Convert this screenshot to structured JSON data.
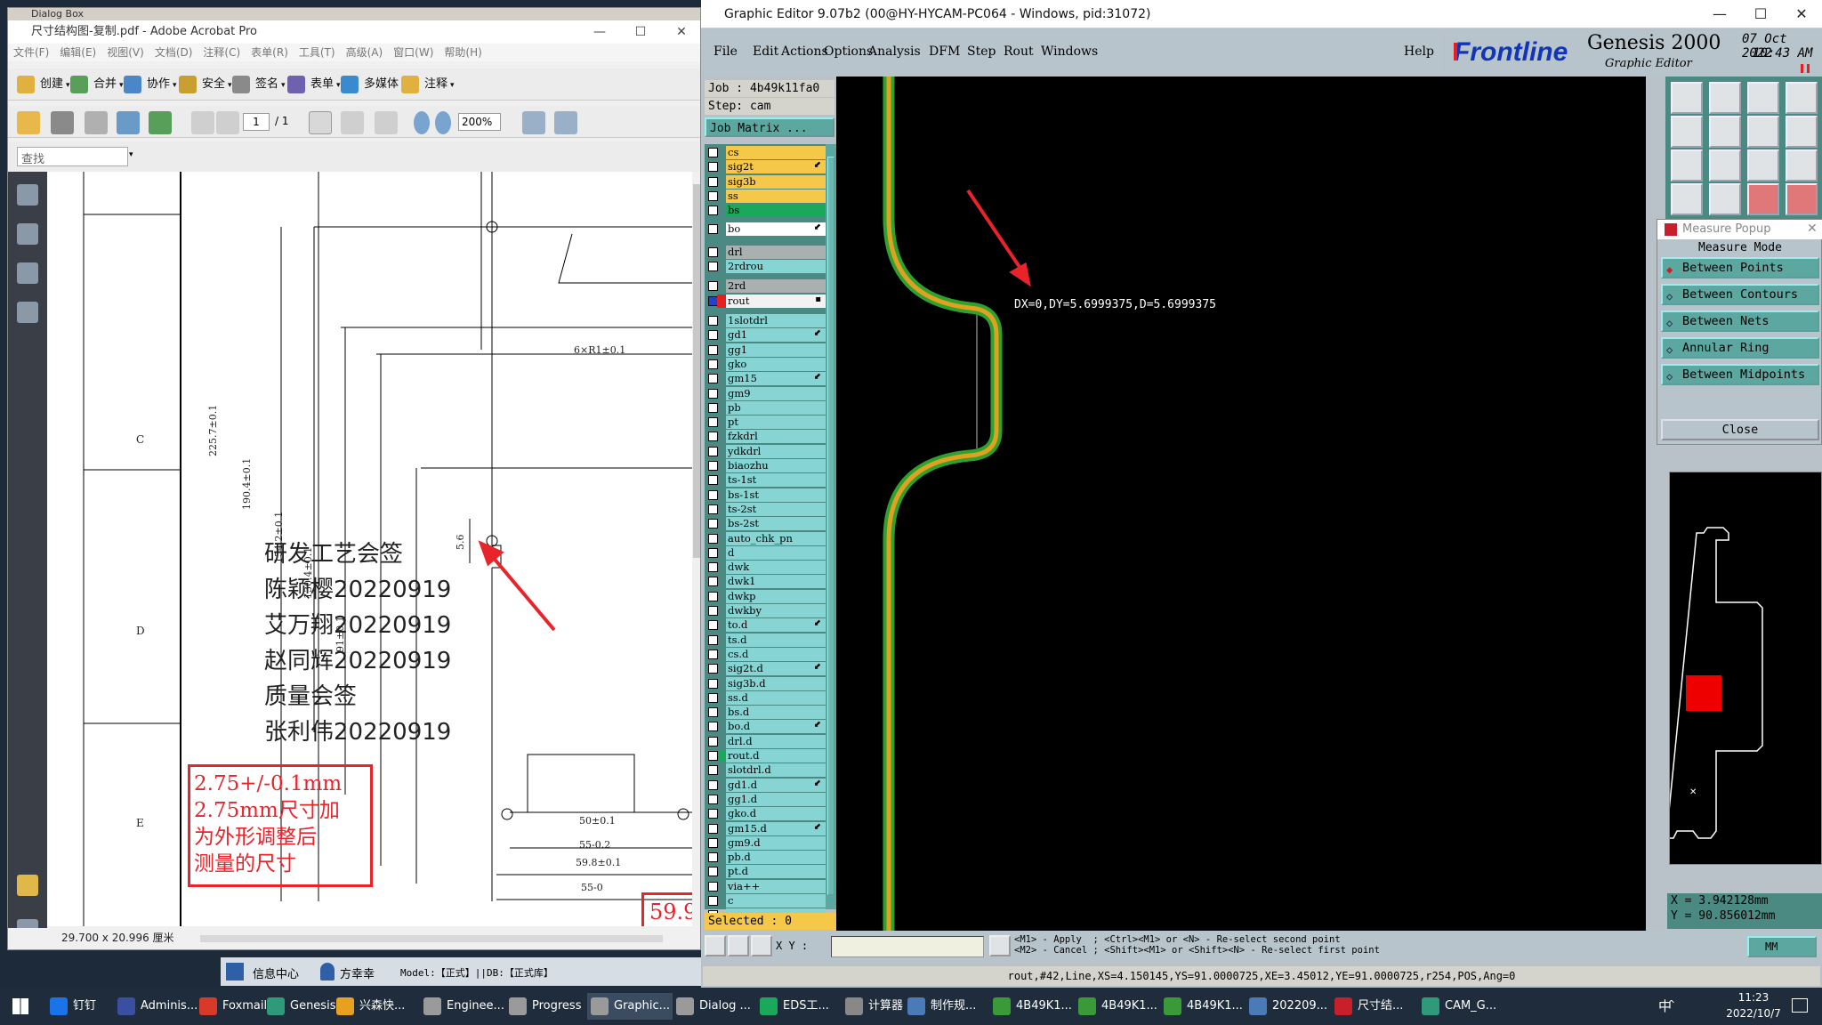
{
  "acrobat": {
    "ghost_title": "Dialog Box",
    "title": "尺寸结构图-复制.pdf - Adobe Acrobat Pro",
    "menu": [
      "文件(F)",
      "编辑(E)",
      "视图(V)",
      "文档(D)",
      "注释(C)",
      "表单(R)",
      "工具(T)",
      "高级(A)",
      "窗口(W)",
      "帮助(H)"
    ],
    "toolbar1": [
      "创建",
      "合并",
      "协作",
      "安全",
      "签名",
      "表单",
      "多媒体",
      "注释"
    ],
    "page_current": "1",
    "page_total": "/ 1",
    "zoom": "200%",
    "find_placeholder": "查找",
    "status_size": "29.700 x 20.996 厘米",
    "drawing": {
      "row_labels": [
        "C",
        "D",
        "E"
      ],
      "dims": [
        "6×R1±0.1",
        "225.7±0.1",
        "190.4±0.1",
        "154.2±0.1",
        "130.4±0.1",
        "91±0.1",
        "5.6",
        "50±0.1",
        "55-0.2",
        "59.8±0.1",
        "55-0"
      ],
      "signoff": [
        "研发工艺会签",
        "陈颖樱20220919",
        "艾万翔20220919",
        "赵同辉20220919",
        "质量会签",
        "张利伟20220919"
      ],
      "red_note": [
        "2.75+/-0.1mm",
        "2.75mm尺寸加",
        "为外形调整后",
        "测量的尺寸"
      ],
      "red_value": "59.9"
    }
  },
  "genesis": {
    "title": "Graphic Editor 9.07b2 (00@HY-HYCAM-PC064 - Windows, pid:31072)",
    "menu": [
      "File",
      "Edit",
      "Actions",
      "Options",
      "Analysis",
      "DFM",
      "Step",
      "Rout",
      "Windows"
    ],
    "help": "Help",
    "logo": "Frontline",
    "product": "Genesis 2000",
    "subtitle": "Graphic Editor",
    "date": "07 Oct 2022",
    "time": "10:43 AM",
    "job": "Job : 4b49k11fa0",
    "step": "Step: cam",
    "job_matrix": "Job Matrix ...",
    "layers": [
      {
        "name": "cs",
        "color": "#f5c84a",
        "mark": ""
      },
      {
        "name": "sig2t",
        "color": "#f5c84a",
        "mark": "⬋"
      },
      {
        "name": "sig3b",
        "color": "#f5c84a",
        "mark": ""
      },
      {
        "name": "ss",
        "color": "#f5c84a",
        "mark": ""
      },
      {
        "name": "bs",
        "color": "#1aa85a",
        "mark": ""
      },
      {
        "name": "bo",
        "color": "#ffffff",
        "mark": "⬋"
      },
      {
        "name": "drl",
        "color": "#a8b0b0",
        "mark": ""
      },
      {
        "name": "2rdrou",
        "color": "#86d4d4",
        "mark": ""
      },
      {
        "name": "2rd",
        "color": "#a8b0b0",
        "mark": ""
      },
      {
        "name": "rout",
        "color": "#f2f2f2",
        "mark": "▪"
      },
      {
        "name": "1slotdrl",
        "color": "#86d4d4",
        "mark": ""
      },
      {
        "name": "gd1",
        "color": "#86d4d4",
        "mark": "⬋"
      },
      {
        "name": "gg1",
        "color": "#86d4d4",
        "mark": ""
      },
      {
        "name": "gko",
        "color": "#86d4d4",
        "mark": ""
      },
      {
        "name": "gm15",
        "color": "#86d4d4",
        "mark": "⬋"
      },
      {
        "name": "gm9",
        "color": "#86d4d4",
        "mark": ""
      },
      {
        "name": "pb",
        "color": "#86d4d4",
        "mark": ""
      },
      {
        "name": "pt",
        "color": "#86d4d4",
        "mark": ""
      },
      {
        "name": "fzkdrl",
        "color": "#86d4d4",
        "mark": ""
      },
      {
        "name": "ydkdrl",
        "color": "#86d4d4",
        "mark": ""
      },
      {
        "name": "biaozhu",
        "color": "#86d4d4",
        "mark": ""
      },
      {
        "name": "ts-1st",
        "color": "#86d4d4",
        "mark": ""
      },
      {
        "name": "bs-1st",
        "color": "#86d4d4",
        "mark": ""
      },
      {
        "name": "ts-2st",
        "color": "#86d4d4",
        "mark": ""
      },
      {
        "name": "bs-2st",
        "color": "#86d4d4",
        "mark": ""
      },
      {
        "name": "auto_chk_pn",
        "color": "#86d4d4",
        "mark": ""
      },
      {
        "name": "d",
        "color": "#86d4d4",
        "mark": ""
      },
      {
        "name": "dwk",
        "color": "#86d4d4",
        "mark": ""
      },
      {
        "name": "dwk1",
        "color": "#86d4d4",
        "mark": ""
      },
      {
        "name": "dwkp",
        "color": "#86d4d4",
        "mark": ""
      },
      {
        "name": "dwkby",
        "color": "#86d4d4",
        "mark": ""
      },
      {
        "name": "to.d",
        "color": "#86d4d4",
        "mark": "⬋"
      },
      {
        "name": "ts.d",
        "color": "#86d4d4",
        "mark": ""
      },
      {
        "name": "cs.d",
        "color": "#86d4d4",
        "mark": ""
      },
      {
        "name": "sig2t.d",
        "color": "#86d4d4",
        "mark": "⬋"
      },
      {
        "name": "sig3b.d",
        "color": "#86d4d4",
        "mark": ""
      },
      {
        "name": "ss.d",
        "color": "#86d4d4",
        "mark": ""
      },
      {
        "name": "bs.d",
        "color": "#86d4d4",
        "mark": ""
      },
      {
        "name": "bo.d",
        "color": "#86d4d4",
        "mark": "⬋"
      },
      {
        "name": "drl.d",
        "color": "#86d4d4",
        "mark": ""
      },
      {
        "name": "rout.d",
        "color": "#86d4d4",
        "mark": ""
      },
      {
        "name": "slotdrl.d",
        "color": "#86d4d4",
        "mark": ""
      },
      {
        "name": "gd1.d",
        "color": "#86d4d4",
        "mark": "⬋"
      },
      {
        "name": "gg1.d",
        "color": "#86d4d4",
        "mark": ""
      },
      {
        "name": "gko.d",
        "color": "#86d4d4",
        "mark": ""
      },
      {
        "name": "gm15.d",
        "color": "#86d4d4",
        "mark": "⬋"
      },
      {
        "name": "gm9.d",
        "color": "#86d4d4",
        "mark": ""
      },
      {
        "name": "pb.d",
        "color": "#86d4d4",
        "mark": ""
      },
      {
        "name": "pt.d",
        "color": "#86d4d4",
        "mark": ""
      },
      {
        "name": "via++",
        "color": "#86d4d4",
        "mark": ""
      },
      {
        "name": "c",
        "color": "#86d4d4",
        "mark": ""
      },
      {
        "name": "s",
        "color": "#86d4d4",
        "mark": ""
      }
    ],
    "selected": "Selected : 0",
    "measure_readout": "DX=0,DY=5.6999375,D=5.6999375",
    "measure_popup": {
      "title": "Measure Popup",
      "mode_label": "Measure Mode",
      "options": [
        "Between Points",
        "Between Contours",
        "Between Nets",
        "Annular Ring",
        "Between Midpoints"
      ],
      "close": "Close"
    },
    "coord_x": "X = 3.942128mm",
    "coord_y": "Y = 90.856012mm",
    "xy_label": "X Y :",
    "hint_line1": "<M1> - Apply  ; <Ctrl><M1> or <N> - Re-select second point",
    "hint_line2": "<M2> - Cancel ; <Shift><M1> or <Shift><N> - Re-select first point",
    "units": "MM",
    "status": "rout,#42,Line,XS=4.150145,YS=91.0000725,XE=3.45012,YE=91.0000725,r254,POS,Ang=0"
  },
  "taskbar": {
    "items": [
      "钉钉",
      "Adminis...",
      "Foxmail",
      "Genesis",
      "兴森快...",
      "Enginee...",
      "Progress",
      "Graphic...",
      "Dialog ...",
      "EDS工...",
      "计算器",
      "制作规...",
      "4B49K1...",
      "4B49K1...",
      "4B49K1...",
      "202209...",
      "尺寸结...",
      "CAM_G..."
    ],
    "ime": "中",
    "clock_time": "11:23",
    "clock_date": "2022/10/7"
  },
  "under_bar": {
    "info_center": "信息中心",
    "user": "方幸幸",
    "model_text": "Model:【正式】||DB:【正式库】"
  }
}
